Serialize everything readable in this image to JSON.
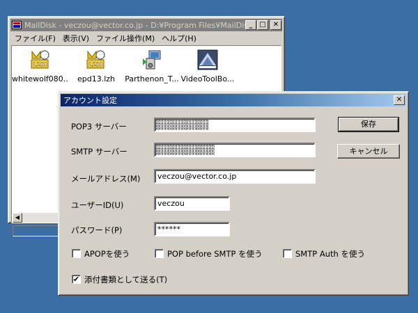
{
  "maildisk": {
    "title": "MailDisk - veczou@vector.co.jp - D:¥Program Files¥MailDisk",
    "menu": [
      "ファイル(F)",
      "表示(V)",
      "ファイル操作(M)",
      "ヘルプ(H)"
    ],
    "files": [
      {
        "name": "whitewolf080...",
        "icon": "lzh-archive-icon"
      },
      {
        "name": "epd13.lzh",
        "icon": "lzh-archive-icon"
      },
      {
        "name": "Parthenon_T...",
        "icon": "installer-icon"
      },
      {
        "name": "VideoToolBo...",
        "icon": "video-tool-icon"
      }
    ]
  },
  "dialog": {
    "title": "アカウント設定",
    "pop3_label": "POP3 サーバー",
    "smtp_label": "SMTP サーバー",
    "mail_label": "メールアドレス(M)",
    "mail_value": "veczou@vector.co.jp",
    "user_label": "ユーザーID(U)",
    "user_value": "veczou",
    "pass_label": "パスワード(P)",
    "pass_value": "******",
    "save_label": "保存",
    "cancel_label": "キャンセル",
    "apop_label": "APOPを使う",
    "apop_checked": false,
    "pbs_label": "POP before SMTP を使う",
    "pbs_checked": false,
    "smtpauth_label": "SMTP Auth を使う",
    "smtpauth_checked": false,
    "attach_label": "添付書類として送る(T)",
    "attach_checked": true
  },
  "colors": {
    "desktop": "#3a6ea5",
    "face": "#d4d0c8",
    "active_title": "#0a246a"
  }
}
